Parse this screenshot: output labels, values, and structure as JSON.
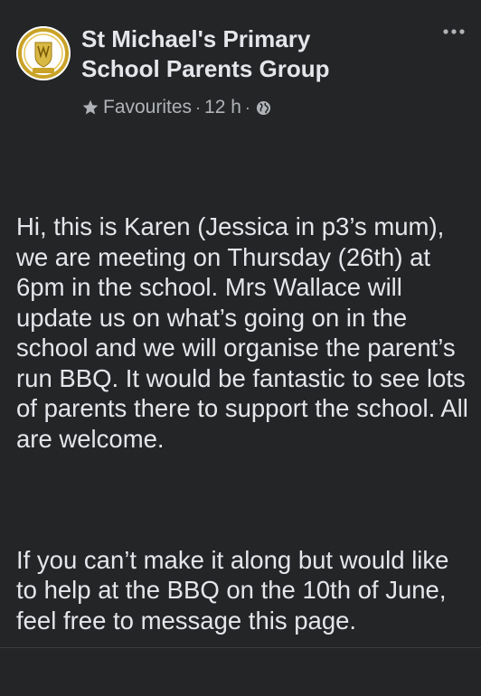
{
  "post": {
    "group_name": "St Michael's Primary School Parents Group",
    "favourites_label": "Favourites",
    "timestamp": "12 h",
    "separator": "·",
    "visibility_icon": "globe-icon",
    "paragraphs": [
      "Hi, this is Karen (Jessica in p3’s mum), we are meeting on Thursday (26th) at 6pm in the school. Mrs Wallace will update us on what’s going on in the school and we will organise the parent’s run BBQ. It would be fantastic to see lots of parents there to support the school. All are welcome.",
      "If you can’t make it along but would like to help at the BBQ on the 10th of June, feel free to message this page."
    ]
  },
  "colors": {
    "background": "#242526",
    "primary_text": "#e4e6eb",
    "secondary_text": "#b0b3b8"
  },
  "icons": {
    "more": "more-horizontal-icon",
    "favourite": "star-icon",
    "avatar": "school-crest-logo"
  }
}
